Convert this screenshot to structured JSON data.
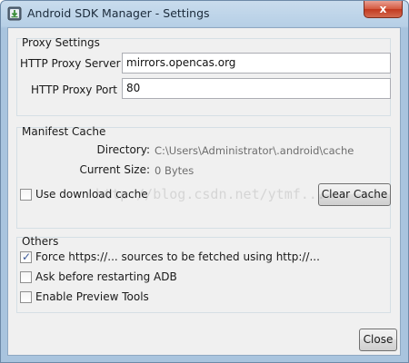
{
  "window": {
    "title": "Android SDK Manager - Settings",
    "close_glyph": "x"
  },
  "proxy": {
    "group_title": "Proxy Settings",
    "server_label": "HTTP Proxy Server",
    "server_value": "mirrors.opencas.org",
    "port_label": "HTTP Proxy Port",
    "port_value": "80"
  },
  "manifest": {
    "group_title": "Manifest Cache",
    "directory_label": "Directory:",
    "directory_value": "C:\\Users\\Administrator\\.android\\cache",
    "size_label": "Current Size:",
    "size_value": "0 Bytes",
    "use_cache_label": "Use download cache",
    "use_cache_checked": false,
    "clear_cache_label": "Clear Cache"
  },
  "others": {
    "group_title": "Others",
    "options": [
      {
        "label": "Force https://... sources to be fetched using http://...",
        "checked": true
      },
      {
        "label": "Ask before restarting ADB",
        "checked": false
      },
      {
        "label": "Enable Preview Tools",
        "checked": false
      }
    ]
  },
  "footer": {
    "close_label": "Close"
  },
  "watermark": {
    "text": "http://blog.csdn.net/ytmf..."
  },
  "icons": {
    "app": "download-arrow-icon",
    "window_close": "close-icon",
    "checkmark": "checkmark-icon"
  },
  "colors": {
    "titlebar": "#b6cfe6",
    "close_button": "#c9442a",
    "client_bg": "#f0f0f0",
    "group_border": "#d5dfe5",
    "dim_text": "#6e6e6e"
  }
}
